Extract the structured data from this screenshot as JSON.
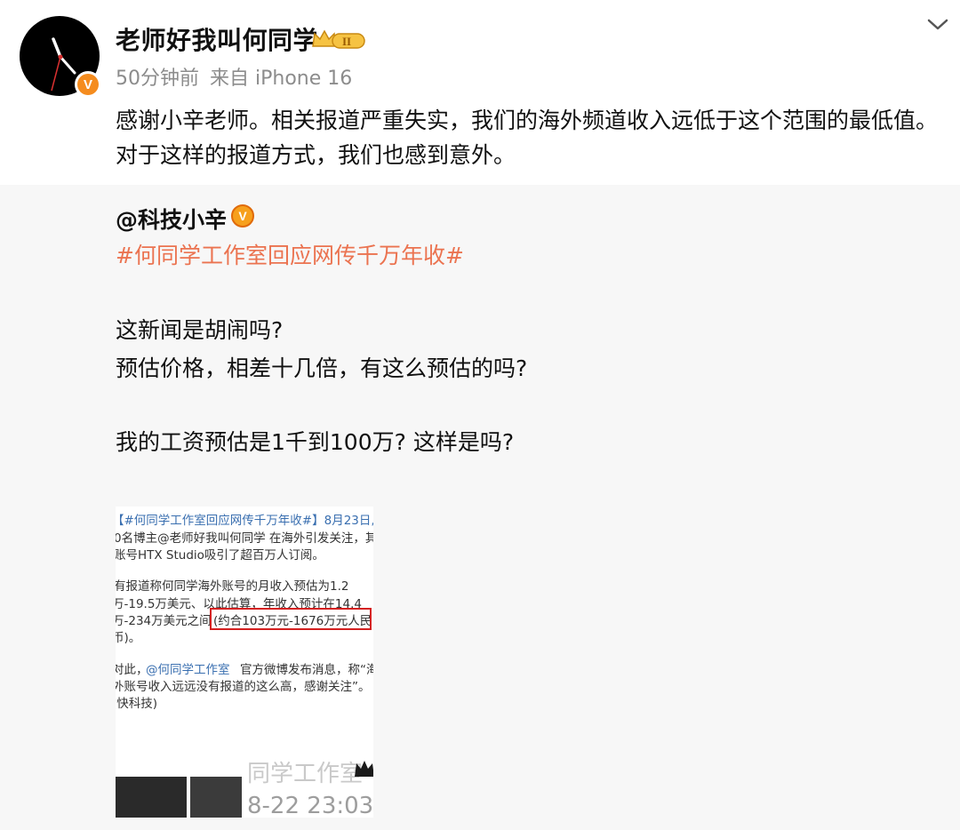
{
  "header": {
    "username": "老师好我叫何同学",
    "vip_level": "II",
    "time": "50分钟前",
    "source": "来自 iPhone 16",
    "avatar_badge": "V"
  },
  "post": {
    "text": "感谢小辛老师。相关报道严重失实，我们的海外频道收入远低于这个范围的最低值。对于这样的报道方式，我们也感到意外。"
  },
  "repost": {
    "author": "@科技小辛",
    "author_badge": "V",
    "hashtag": "#何同学工作室回应网传千万年收#",
    "lines": [
      "这新闻是胡闹吗?",
      "预估价格，相差十几倍，有这么预估的吗?",
      "我的工资预估是1千到100万? 这样是吗?"
    ],
    "image": {
      "lines": [
        "【#何同学工作室回应网传千万年收#】8月23日,",
        "0名博主@老师好我叫何同学 在海外引发关注，其",
        "账号HTX Studio吸引了超百万人订阅。",
        "有报道称何同学海外账号的月收入预估为1.2",
        "万-19.5万美元、以此估算，年收入预计在14.4",
        "万-234万美元之间",
        "(约合103万元-1676万元人民",
        "币)。",
        "对此，",
        "@何同学工作室",
        "官方微博发布消息，称“海",
        "外账号收入远远没有报道的这么高，感谢关注”。",
        "(快科技)"
      ],
      "watermark": "同学工作室",
      "timestamp": "8-22 23:03"
    }
  },
  "colors": {
    "accent": "#eb7350",
    "meta": "#8c8c8c",
    "repost_bg": "#f7f7f7",
    "badge": "#f58c1e"
  }
}
